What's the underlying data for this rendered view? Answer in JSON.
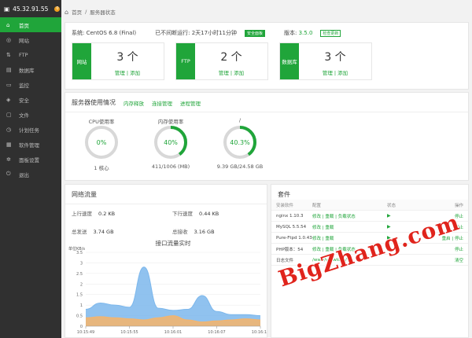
{
  "sidebar": {
    "ip": "45.32.91.55",
    "badge": "0",
    "items": [
      {
        "label": "首页",
        "icon": "home-icon",
        "glyph": "⌂"
      },
      {
        "label": "网站",
        "icon": "globe-icon",
        "glyph": "◎"
      },
      {
        "label": "FTP",
        "icon": "ftp-icon",
        "glyph": "⇅"
      },
      {
        "label": "数据库",
        "icon": "database-icon",
        "glyph": "▤"
      },
      {
        "label": "监控",
        "icon": "monitor-icon",
        "glyph": "▭"
      },
      {
        "label": "安全",
        "icon": "shield-icon",
        "glyph": "◈"
      },
      {
        "label": "文件",
        "icon": "folder-icon",
        "glyph": "▢"
      },
      {
        "label": "计划任务",
        "icon": "clock-icon",
        "glyph": "◷"
      },
      {
        "label": "软件管理",
        "icon": "apps-icon",
        "glyph": "▦"
      },
      {
        "label": "面板设置",
        "icon": "gear-icon",
        "glyph": "✲"
      },
      {
        "label": "退出",
        "icon": "exit-icon",
        "glyph": "⏻"
      }
    ]
  },
  "breadcrumb": {
    "home": "首页",
    "sep": "/",
    "current": "服务器状态"
  },
  "system": {
    "os_label": "系统:",
    "os": "CentOS 6.8 (Final)",
    "uptime_label": "已不间断运行:",
    "uptime": "2天17小时11分钟",
    "safe_badge": "安全面板",
    "version_label": "版本:",
    "version": "3.5.0",
    "update_badge": "检查更新"
  },
  "cards": [
    {
      "label": "网站",
      "count": "3 个",
      "manage": "管理",
      "add": "添加"
    },
    {
      "label": "FTP",
      "count": "2 个",
      "manage": "管理",
      "add": "添加"
    },
    {
      "label": "数据库",
      "count": "3 个",
      "manage": "管理",
      "add": "添加"
    }
  ],
  "usage": {
    "title": "服务器使用情况",
    "links": [
      "内存释放",
      "连接管理",
      "进程管理"
    ],
    "gauges": [
      {
        "name": "CPU使用率",
        "value": "0%",
        "percent": 0,
        "footer": "1 核心"
      },
      {
        "name": "内存使用率",
        "value": "40%",
        "percent": 40,
        "footer": "411/1006 (MB)"
      },
      {
        "name": "/",
        "value": "40.3%",
        "percent": 40.3,
        "footer": "9.39 GB/24.58 GB"
      }
    ]
  },
  "network": {
    "title": "网络流量",
    "up_label": "上行速度",
    "up": "0.2 KB",
    "down_label": "下行速度",
    "down": "0.44 KB",
    "sent_label": "总发送",
    "sent": "3.74 GB",
    "recv_label": "总接收",
    "recv": "3.16 GB"
  },
  "chart_data": {
    "type": "area",
    "title": "接口流量实时",
    "ylabel": "单位KB/s",
    "ylim": [
      0,
      3.5
    ],
    "yticks": [
      "0",
      "0.5",
      "1",
      "1.5",
      "2",
      "2.5",
      "3",
      "3.5"
    ],
    "xticks": [
      "10:15:49",
      "10:15:55",
      "10:16:01",
      "10:16:07",
      "10:16:13"
    ],
    "x": [
      0,
      1,
      2,
      3,
      4,
      5,
      6,
      7,
      8,
      9,
      10,
      11,
      12
    ],
    "series": [
      {
        "values": [
          0.8,
          1.1,
          1.0,
          0.9,
          2.8,
          0.85,
          0.75,
          0.8,
          1.45,
          0.7,
          0.55,
          0.55,
          0.5
        ],
        "color": "#7cb7ec"
      },
      {
        "values": [
          0.4,
          0.45,
          0.4,
          0.35,
          0.3,
          0.4,
          0.5,
          0.3,
          0.2,
          0.25,
          0.3,
          0.35,
          0.3
        ],
        "color": "#f7b469"
      }
    ]
  },
  "software": {
    "title": "套件",
    "headers": [
      "安装软件",
      "配置",
      "状态",
      "操作"
    ],
    "rows": [
      {
        "name": "nginx 1.10.3",
        "config": "修改 | 重载 | 负载状态",
        "status": "▶",
        "op": "停止"
      },
      {
        "name": "MySQL 5.5.54",
        "config": "修改 | 重载",
        "status": "▶",
        "op": "停止"
      },
      {
        "name": "Pure-Ftpd 1.0.43",
        "config": "修改 | 重载",
        "status": "▶",
        "op": "重启 | 停止"
      },
      {
        "name": "PHP版本：54",
        "config": "修改 | 重载 | 负载状态",
        "status": "▶",
        "op": "停止"
      },
      {
        "name": "日志文件",
        "config": "/www/wwwlogs/",
        "status": "",
        "op": "清空"
      }
    ]
  },
  "watermark": "BigZhang.com",
  "colors": {
    "accent": "#20a53a",
    "sidebar": "#303030"
  }
}
